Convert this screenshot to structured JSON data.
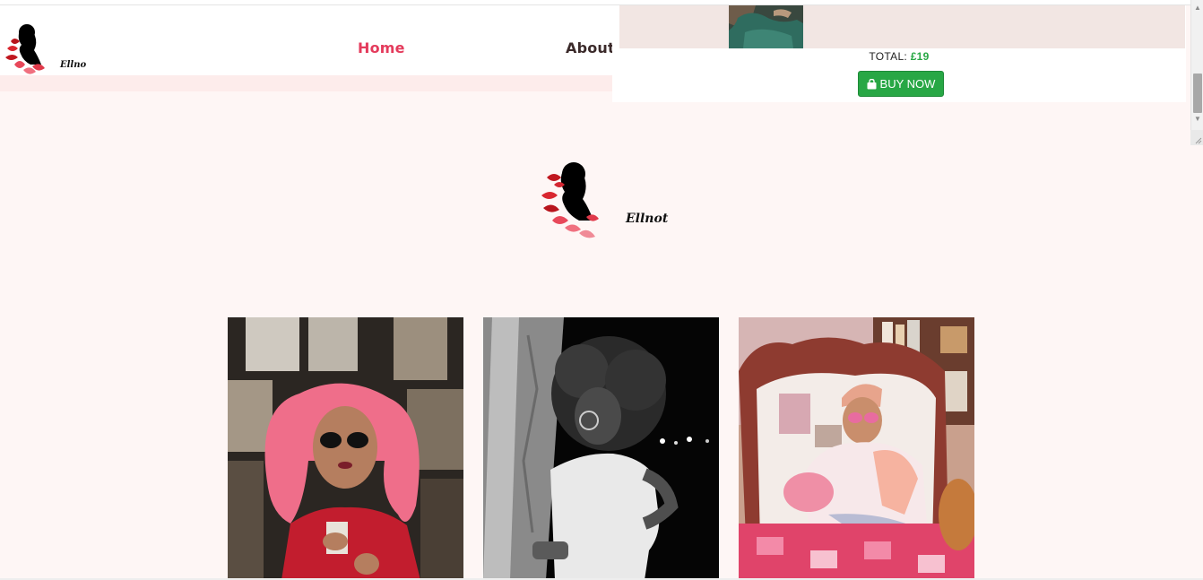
{
  "brand": {
    "name": "Ellnot"
  },
  "nav": {
    "home": "Home",
    "about": "About"
  },
  "cart": {
    "total_label": "TOTAL:",
    "total_amount": "£19",
    "buy_now": "BUY NOW"
  },
  "colors": {
    "accent": "#e43b5c",
    "buy_button": "#28a745",
    "page_bg": "#fef6f5"
  },
  "gallery": [
    {
      "subject": "woman with pink curly hair in red coat"
    },
    {
      "subject": "woman with afro in black and white"
    },
    {
      "subject": "woman in pastel outfit on pink bed"
    }
  ]
}
